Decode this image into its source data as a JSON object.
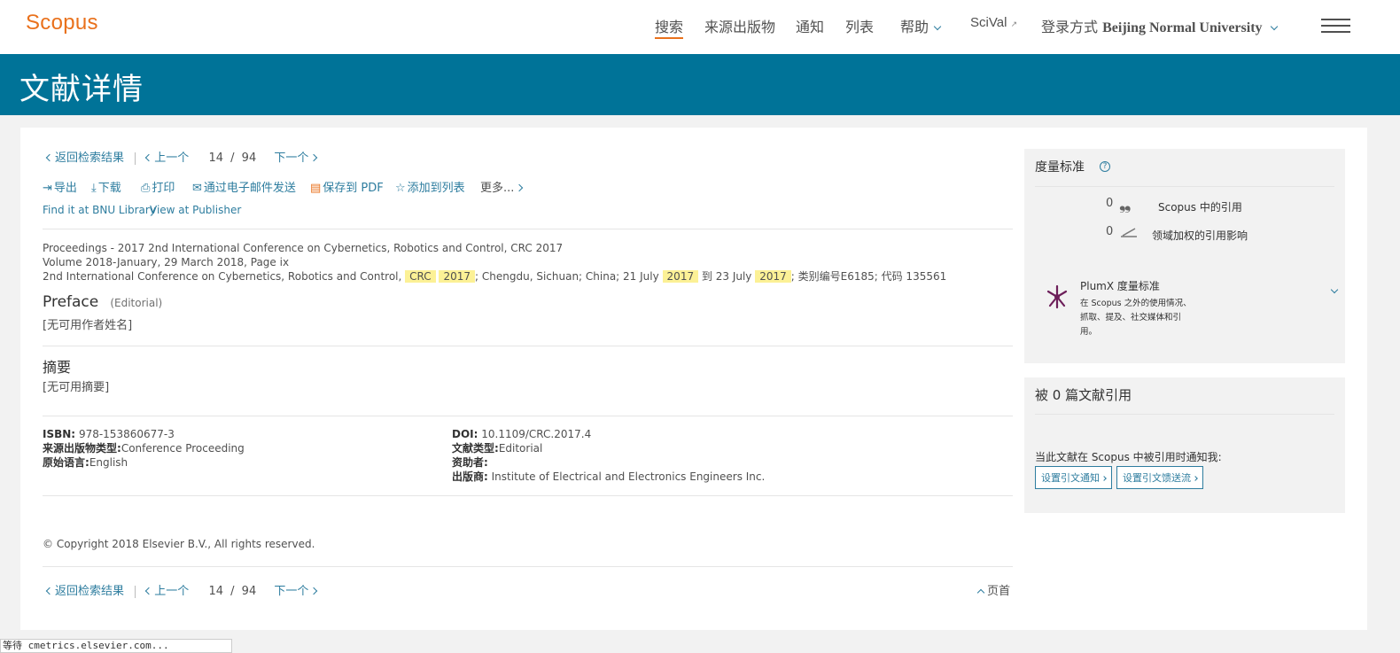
{
  "header": {
    "logo": "Scopus",
    "nav": {
      "search": "搜索",
      "sources": "来源出版物",
      "alerts": "通知",
      "lists": "列表",
      "help": "帮助",
      "scival": "SciVal",
      "scival_ext": "↗",
      "login_prefix": "登录方式",
      "institution": "Beijing Normal University"
    }
  },
  "banner": {
    "title": "文献详情"
  },
  "pager": {
    "back": "返回检索结果",
    "prev": "上一个",
    "current": "14",
    "slash": "/",
    "total": "94",
    "next": "下一个"
  },
  "actions": {
    "export": "导出",
    "download": "下载",
    "print": "打印",
    "email": "通过电子邮件发送",
    "save_pdf": "保存到 PDF",
    "add_list": "添加到列表",
    "more": "更多..."
  },
  "links": {
    "find_bnu": "Find it at BNU Library",
    "view_publisher": "View at Publisher"
  },
  "source": {
    "line1": "Proceedings - 2017 2nd International Conference on Cybernetics, Robotics and Control, CRC 2017",
    "line2": "Volume 2018-January, 29 March 2018, Page ix",
    "line3_a": "2nd International Conference on Cybernetics, Robotics and Control,",
    "line3_hl1": "CRC",
    "line3_hl2": "2017",
    "line3_b": "; Chengdu, Sichuan; China; 21 July",
    "line3_hl3": "2017",
    "line3_c": "到 23 July",
    "line3_hl4": "2017",
    "line3_d": "; 类别编号E6185; 代码 135561"
  },
  "document": {
    "title": "Preface",
    "type_tag": "(Editorial)",
    "authors": "[无可用作者姓名]"
  },
  "abstract": {
    "heading": "摘要",
    "text": "[无可用摘要]"
  },
  "details": {
    "isbn_label": "ISBN:",
    "isbn": "978-153860677-3",
    "source_type_label": "来源出版物类型:",
    "source_type": "Conference Proceeding",
    "language_label": "原始语言:",
    "language": "English",
    "doi_label": "DOI:",
    "doi": "10.1109/CRC.2017.4",
    "doc_type_label": "文献类型:",
    "doc_type": "Editorial",
    "sponsor_label": "资助者:",
    "publisher_label": "出版商:",
    "publisher": "Institute of Electrical and Electronics Engineers Inc."
  },
  "copyright": "© Copyright 2018 Elsevier B.V., All rights reserved.",
  "bottom": {
    "top_link": "页首"
  },
  "metrics": {
    "heading": "度量标准",
    "help_icon": "?",
    "citations_count": "0",
    "citations_label": "Scopus 中的引用",
    "fwci_count": "0",
    "fwci_label": "领域加权的引用影响",
    "plumx_title": "PlumX 度量标准",
    "plumx_desc1": "在 Scopus 之外的使用情况、",
    "plumx_desc2": "抓取、提及、社交媒体和引",
    "plumx_desc3": "用。"
  },
  "cited_by": {
    "heading": "被 0 篇文献引用",
    "notify_text": "当此文献在 Scopus 中被引用时通知我:",
    "alert_button": "设置引文通知",
    "feed_button": "设置引文馈送流"
  },
  "status_bar": "等待 cmetrics.elsevier.com..."
}
